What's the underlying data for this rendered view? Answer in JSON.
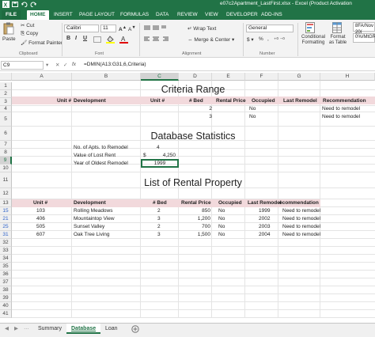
{
  "window": {
    "title": "e07c2Apartment_LastFirst.xlsx -  Excel (Product Activation"
  },
  "ribbon_tabs": [
    "FILE",
    "HOME",
    "INSERT",
    "PAGE LAYOUT",
    "FORMULAS",
    "DATA",
    "REVIEW",
    "VIEW",
    "DEVELOPER",
    "ADD-INS"
  ],
  "ribbon": {
    "cut": "Cut",
    "copy": "Copy",
    "format_painter": "Format Painter",
    "paste": "Paste",
    "clipboard_group": "Clipboard",
    "font_name": "Calibri",
    "font_size": "11",
    "font_group": "Font",
    "bold": "B",
    "italic": "I",
    "underline": "U",
    "wrap_text": "Wrap Text",
    "merge_center": "Merge & Center",
    "alignment_group": "Alignment",
    "number_format": "General",
    "number_group": "Number",
    "conditional_formatting": "Conditional Formatting",
    "format_as_table": "Format as Table",
    "styles_preview": "8FA/Nov 20(",
    "styles_preview2": "0%/MtGR"
  },
  "formula_bar": {
    "name_box": "C9",
    "formula": "=DMIN(A13:G31,6,Criteria)",
    "fx": "fx"
  },
  "columns": [
    "A",
    "B",
    "C",
    "D",
    "E",
    "F",
    "G",
    "H"
  ],
  "rows": [
    "1",
    "2",
    "3",
    "4",
    "5",
    "6",
    "7",
    "8",
    "9",
    "10",
    "11",
    "12",
    "13",
    "15",
    "21",
    "25",
    "31",
    "32",
    "33",
    "34",
    "35",
    "36",
    "37",
    "38",
    "39",
    "40",
    "41"
  ],
  "criteria": {
    "title": "Criteria Range",
    "headers": [
      "Unit #",
      "Development",
      "Unit #",
      "# Bed",
      "Rental Price",
      "Occupied",
      "Last Remodel",
      "Recommendation"
    ],
    "row2": {
      "bed": "2",
      "occupied": "No",
      "rec": "Need to remodel"
    },
    "row3": {
      "bed": "3",
      "occupied": "No",
      "rec": "Need to remodel"
    }
  },
  "stats": {
    "title": "Database Statistics",
    "apts_label": "No. of Apts. to Remodel",
    "apts_value": "4",
    "rent_label": "Value of Lost Rent",
    "rent_currency": "$",
    "rent_value": "4,250",
    "oldest_label": "Year of Oldest Remodel",
    "oldest_value": "1999"
  },
  "rental": {
    "title": "List of Rental Property",
    "headers": [
      "Unit #",
      "Development",
      "# Bed",
      "Rental Price",
      "Occupied",
      "Last Remodel",
      "ecommendation"
    ],
    "rows": [
      {
        "unit": "103",
        "dev": "Rolling Meadows",
        "bed": "2",
        "price": "850",
        "occ": "No",
        "remodel": "1999",
        "rec": "Need to remodel"
      },
      {
        "unit": "406",
        "dev": "Mountaintop View",
        "bed": "3",
        "price": "1,200",
        "occ": "No",
        "remodel": "2002",
        "rec": "Need to remodel"
      },
      {
        "unit": "505",
        "dev": "Sunset Valley",
        "bed": "2",
        "price": "700",
        "occ": "No",
        "remodel": "2003",
        "rec": "Need to remodel"
      },
      {
        "unit": "607",
        "dev": "Oak Tree Living",
        "bed": "3",
        "price": "1,500",
        "occ": "No",
        "remodel": "2004",
        "rec": "Need to remodel"
      }
    ]
  },
  "sheets": [
    "Summary",
    "Database",
    "Loan"
  ],
  "active_sheet": "Database",
  "colors": {
    "excel_green": "#217346",
    "header_band": "#f2d9dc"
  }
}
